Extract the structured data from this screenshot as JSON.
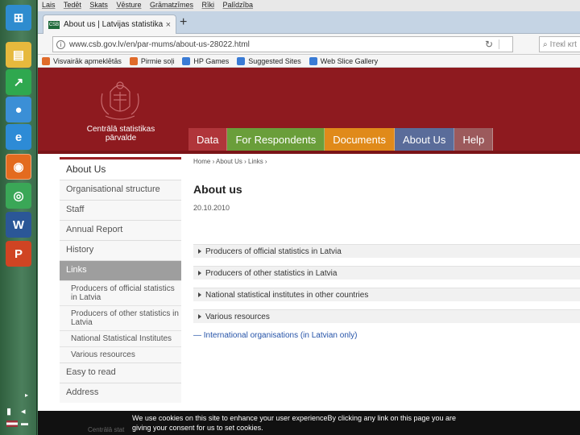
{
  "taskbar": {
    "apps": [
      {
        "name": "windows",
        "color": "#2e8ccf",
        "glyph": "⊞"
      },
      {
        "name": "explorer",
        "color": "#e6b93d",
        "glyph": "▤"
      },
      {
        "name": "monitor",
        "color": "#2fa84f",
        "glyph": "↗"
      },
      {
        "name": "wifi",
        "color": "#3b8fd6",
        "glyph": "●"
      },
      {
        "name": "ie",
        "color": "#2d8bd6",
        "glyph": "e"
      },
      {
        "name": "firefox",
        "color": "#e36b1f",
        "glyph": "◉"
      },
      {
        "name": "chrome",
        "color": "#3aa757",
        "glyph": "◎"
      },
      {
        "name": "word",
        "color": "#2b5797",
        "glyph": "W"
      },
      {
        "name": "powerpoint",
        "color": "#d04423",
        "glyph": "P"
      }
    ]
  },
  "browser": {
    "menu": [
      "Lais",
      "Tedēt",
      "Skats",
      "Vēsture",
      "Grāmatzīmes",
      "Rīki",
      "Palīdzība"
    ],
    "tab_title": "About us | Latvijas statistika",
    "tab_favicon": "CSB",
    "new_tab": "+",
    "url": "www.csb.gov.lv/en/par-mums/about-us-28022.html",
    "search_placeholder": "Ітекl ĸrt",
    "bookmarks": [
      {
        "label": "Visvairāk apmeklētās",
        "color": "#e06b2a"
      },
      {
        "label": "Pirmie soļi",
        "color": "#e06b2a"
      },
      {
        "label": "HP Games",
        "color": "#3a7bd5"
      },
      {
        "label": "Suggested Sites",
        "color": "#3a7bd5"
      },
      {
        "label": "Web Slice Gallery",
        "color": "#3a7bd5"
      }
    ]
  },
  "site": {
    "org_name_line1": "Centrālā statistikas",
    "org_name_line2": "pārvalde",
    "nav": [
      {
        "label": "Data",
        "color": "#b0353a"
      },
      {
        "label": "For Respondents",
        "color": "#6a9e3a"
      },
      {
        "label": "Documents",
        "color": "#e08a1a"
      },
      {
        "label": "About Us",
        "color": "#5a6c9a"
      },
      {
        "label": "Help",
        "color": "#9c5a5c"
      }
    ],
    "sidebar": {
      "heading": "About Us",
      "items": [
        "Organisational structure",
        "Staff",
        "Annual Report",
        "History",
        "Links"
      ],
      "sub_items": [
        "Producers of official statistics in Latvia",
        "Producers of other statistics in Latvia",
        "National Statistical Institutes",
        "Various resources"
      ],
      "after_items": [
        "Easy to read",
        "Address"
      ]
    },
    "breadcrumb": "Home › About Us › Links ›",
    "title": "About us",
    "date": "20.10.2010",
    "sections": [
      "Producers of official statistics in Latvia",
      "Producers of other statistics in Latvia",
      "National statistical institutes in other countries",
      "Various resources"
    ],
    "intl_link": "— International organisations (in Latvian only)",
    "cookie_line1": "We use cookies on this site to enhance your user experienceBy clicking any link on this page you are",
    "cookie_line2": "giving your consent for us to set cookies.",
    "footer_faded": "Centrālā stat"
  }
}
